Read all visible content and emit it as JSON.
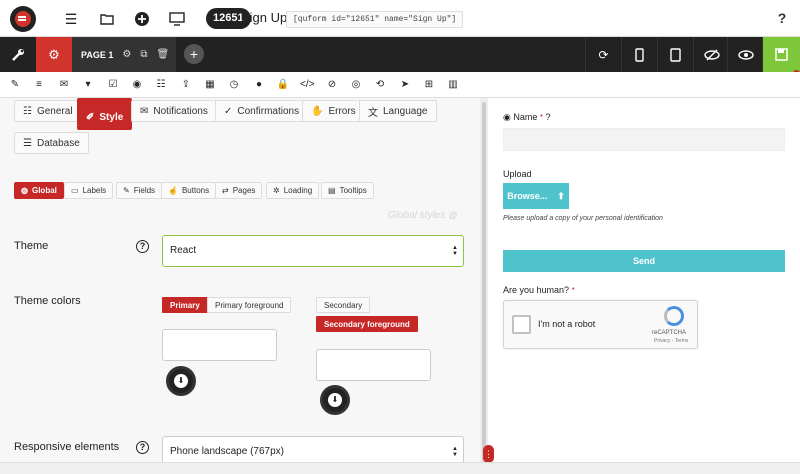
{
  "header": {
    "form_id": "12651",
    "form_name": "Sign Up",
    "shortcode": "[quform id=\"12651\" name=\"Sign Up\"]",
    "help": "?"
  },
  "pagebar": {
    "page_label": "PAGE 1",
    "add": "+"
  },
  "settings_tabs": [
    "General",
    "Style",
    "Notifications",
    "Confirmations",
    "Errors",
    "Language",
    "Database"
  ],
  "style_subtabs": [
    "Global",
    "Labels",
    "Fields",
    "Buttons",
    "Pages",
    "Loading",
    "Tooltips"
  ],
  "watermark": "Global styles",
  "theme": {
    "label": "Theme",
    "value": "React"
  },
  "theme_colors": {
    "label": "Theme colors",
    "primary": "Primary",
    "primary_fg": "Primary foreground",
    "secondary": "Secondary",
    "secondary_fg": "Secondary foreground"
  },
  "responsive": {
    "label": "Responsive elements",
    "value": "Phone landscape (767px)"
  },
  "preview": {
    "name_label": "Name",
    "upload_label": "Upload",
    "browse": "Browse...",
    "upload_hint": "Please upload a copy of your personal identification",
    "send": "Send",
    "human_label": "Are you human?",
    "captcha_text": "I'm not a robot",
    "captcha_brand": "reCAPTCHA",
    "captcha_terms": "Privacy - Terms"
  },
  "colors": {
    "accent_red": "#c62828",
    "save_green": "#7ec63a",
    "teal": "#4fc3cc"
  }
}
